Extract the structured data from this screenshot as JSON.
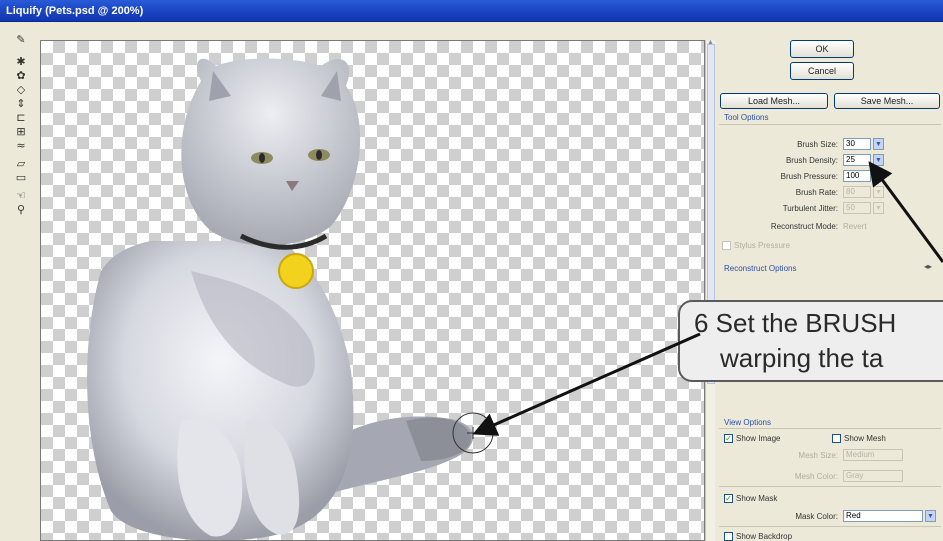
{
  "window": {
    "title": "Liquify (Pets.psd @ 200%)"
  },
  "toolbox": {
    "tools": [
      "forward-warp-icon",
      "reconstruct-icon",
      "twirl-icon",
      "pucker-icon",
      "bloat-icon",
      "push-left-icon",
      "mirror-icon",
      "turbulence-icon",
      "freeze-mask-icon",
      "thaw-mask-icon",
      "hand-icon",
      "zoom-icon"
    ]
  },
  "buttons": {
    "ok": "OK",
    "cancel": "Cancel",
    "load_mesh": "Load Mesh...",
    "save_mesh": "Save Mesh..."
  },
  "tool_options": {
    "heading": "Tool Options",
    "brush_size_label": "Brush Size:",
    "brush_size": "30",
    "brush_density_label": "Brush Density:",
    "brush_density": "25",
    "brush_pressure_label": "Brush Pressure:",
    "brush_pressure": "100",
    "brush_rate_label": "Brush Rate:",
    "brush_rate": "80",
    "turbulent_jitter_label": "Turbulent Jitter:",
    "turbulent_jitter": "50",
    "reconstruct_mode_label": "Reconstruct Mode:",
    "reconstruct_mode": "Revert",
    "stylus_pressure_label": "Stylus Pressure"
  },
  "reconstruct_options": {
    "heading": "Reconstruct Options"
  },
  "view_options": {
    "heading": "View Options",
    "show_image_label": "Show Image",
    "show_image": true,
    "show_mesh_label": "Show Mesh",
    "show_mesh": false,
    "mesh_size_label": "Mesh Size:",
    "mesh_size": "Medium",
    "mesh_color_label": "Mesh Color:",
    "mesh_color": "Gray",
    "show_mask_label": "Show Mask",
    "show_mask": true,
    "mask_color_label": "Mask Color:",
    "mask_color": "Red",
    "show_backdrop_label": "Show Backdrop",
    "show_backdrop": false
  },
  "callout": {
    "line1": "6  Set the BRUSH",
    "line2": "warping the ta"
  },
  "colors": {
    "titlebar": "#1d47c5",
    "accent_text": "#2b4fa8",
    "callout_bg": "#eeeeef",
    "tag": "#f2d21c"
  }
}
